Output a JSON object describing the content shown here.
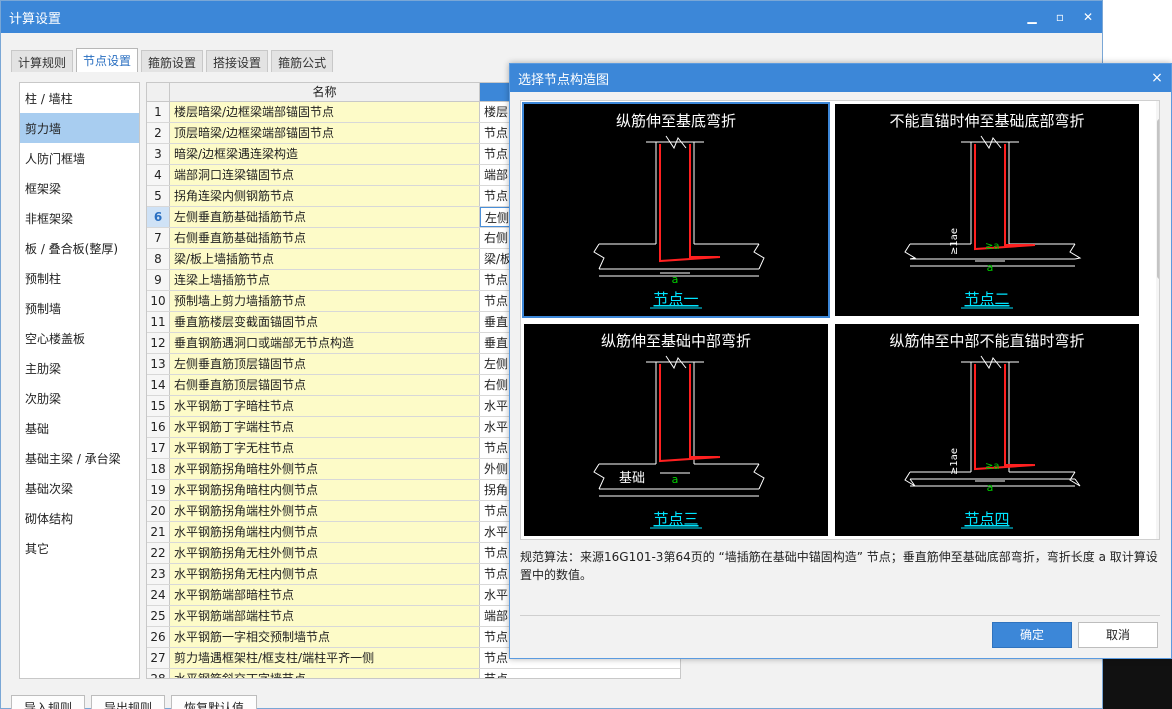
{
  "main": {
    "title": "计算设置",
    "tabs": [
      "计算规则",
      "节点设置",
      "箍筋设置",
      "搭接设置",
      "箍筋公式"
    ],
    "active_tab": 1,
    "left_items": [
      "柱 / 墙柱",
      "剪力墙",
      "人防门框墙",
      "框架梁",
      "非框架梁",
      "板 / 叠合板(整厚)",
      "预制柱",
      "预制墙",
      "空心楼盖板",
      "主肋梁",
      "次肋梁",
      "基础",
      "基础主梁 / 承台梁",
      "基础次梁",
      "砌体结构",
      "其它"
    ],
    "active_left": 1,
    "grid_header": "名称",
    "rows": [
      {
        "n": "1",
        "name": "楼层暗梁/边框梁端部锚固节点",
        "val": "楼层"
      },
      {
        "n": "2",
        "name": "顶层暗梁/边框梁端部锚固节点",
        "val": "节点"
      },
      {
        "n": "3",
        "name": "暗梁/边框梁遇连梁构造",
        "val": "节点"
      },
      {
        "n": "4",
        "name": "端部洞口连梁锚固节点",
        "val": "端部"
      },
      {
        "n": "5",
        "name": "拐角连梁内侧钢筋节点",
        "val": "节点"
      },
      {
        "n": "6",
        "name": "左侧垂直筋基础插筋节点",
        "val": "左侧"
      },
      {
        "n": "7",
        "name": "右侧垂直筋基础插筋节点",
        "val": "右侧"
      },
      {
        "n": "8",
        "name": "梁/板上墙插筋节点",
        "val": "梁/板"
      },
      {
        "n": "9",
        "name": "连梁上墙插筋节点",
        "val": "节点"
      },
      {
        "n": "10",
        "name": "预制墙上剪力墙插筋节点",
        "val": "节点"
      },
      {
        "n": "11",
        "name": "垂直筋楼层变截面锚固节点",
        "val": "垂直"
      },
      {
        "n": "12",
        "name": "垂直钢筋遇洞口或端部无节点构造",
        "val": "垂直"
      },
      {
        "n": "13",
        "name": "左侧垂直筋顶层锚固节点",
        "val": "左侧"
      },
      {
        "n": "14",
        "name": "右侧垂直筋顶层锚固节点",
        "val": "右侧"
      },
      {
        "n": "15",
        "name": "水平钢筋丁字暗柱节点",
        "val": "水平"
      },
      {
        "n": "16",
        "name": "水平钢筋丁字端柱节点",
        "val": "水平"
      },
      {
        "n": "17",
        "name": "水平钢筋丁字无柱节点",
        "val": "节点"
      },
      {
        "n": "18",
        "name": "水平钢筋拐角暗柱外侧节点",
        "val": "外侧"
      },
      {
        "n": "19",
        "name": "水平钢筋拐角暗柱内侧节点",
        "val": "拐角"
      },
      {
        "n": "20",
        "name": "水平钢筋拐角端柱外侧节点",
        "val": "节点"
      },
      {
        "n": "21",
        "name": "水平钢筋拐角端柱内侧节点",
        "val": "水平"
      },
      {
        "n": "22",
        "name": "水平钢筋拐角无柱外侧节点",
        "val": "节点"
      },
      {
        "n": "23",
        "name": "水平钢筋拐角无柱内侧节点",
        "val": "节点"
      },
      {
        "n": "24",
        "name": "水平钢筋端部暗柱节点",
        "val": "水平"
      },
      {
        "n": "25",
        "name": "水平钢筋端部端柱节点",
        "val": "端部"
      },
      {
        "n": "26",
        "name": "水平钢筋一字相交预制墙节点",
        "val": "节点"
      },
      {
        "n": "27",
        "name": "剪力墙遇框架柱/框支柱/端柱平齐一侧",
        "val": "节点"
      },
      {
        "n": "28",
        "name": "水平钢筋斜交丁字墙节点",
        "val": "节点"
      }
    ],
    "selected_row": 5,
    "bottom_buttons": [
      "导入规则",
      "导出规则",
      "恢复默认值"
    ]
  },
  "modal": {
    "title": "选择节点构造图",
    "close": "×",
    "thumbs": [
      {
        "caption": "纵筋伸至基底弯折",
        "label": "节点一",
        "selected": true
      },
      {
        "caption": "不能直锚时伸至基础底部弯折",
        "label": "节点二",
        "selected": false
      },
      {
        "caption": "纵筋伸至基础中部弯折",
        "label": "节点三",
        "selected": false
      },
      {
        "caption": "纵筋伸至中部不能直锚时弯折",
        "label": "节点四",
        "selected": false
      }
    ],
    "dim_a": "a",
    "dim_lae": "≥1ae",
    "dim_ge_a": "≥a",
    "base_label": "基础",
    "description": "规范算法：来源16G101-3第64页的 “墙插筋在基础中锚固构造” 节点；垂直筋伸至基础底部弯折，弯折长度 a 取计算设置中的数值。",
    "ok": "确定",
    "cancel": "取消"
  },
  "colors": {
    "accent": "#3c87d8",
    "rebar": "#ff2020",
    "dim": "#00d000",
    "label": "#00e5ff"
  }
}
